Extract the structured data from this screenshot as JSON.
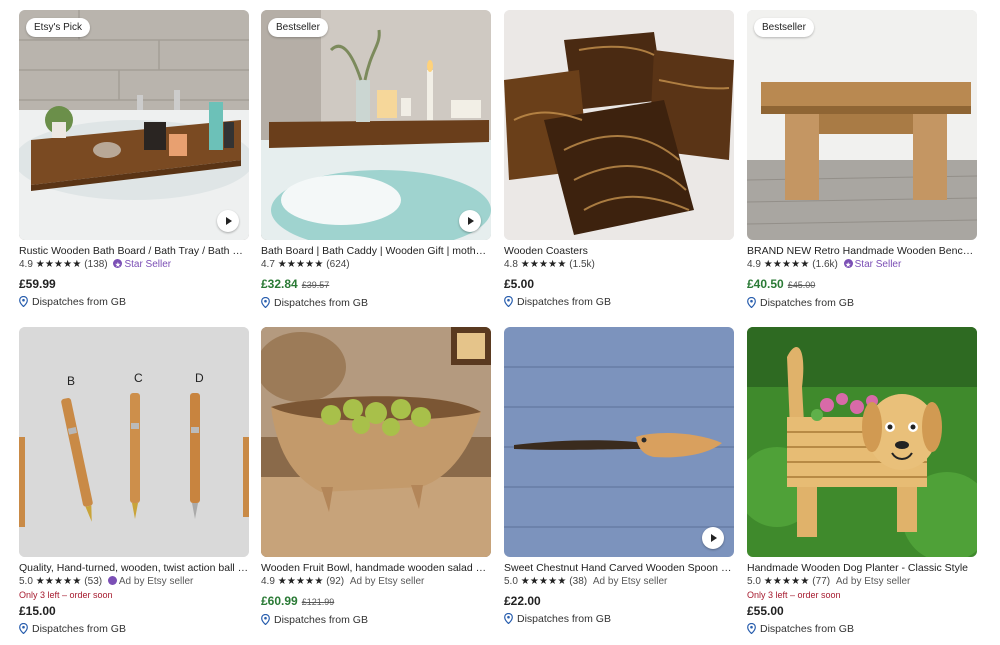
{
  "listings": [
    {
      "badge": "Etsy's Pick",
      "title": "Rustic Wooden Bath Board / Bath Tray / Bath Caddy",
      "rating": "4.9",
      "reviews": "(138)",
      "seller_badge": "Star Seller",
      "price": "£59.99",
      "dispatch": "Dispatches from GB",
      "video": true
    },
    {
      "badge": "Bestseller",
      "title": "Bath Board | Bath Caddy | Wooden Gift | mothers day gift",
      "rating": "4.7",
      "reviews": "(624)",
      "price": "£32.84",
      "original_price": "£39.57",
      "dispatch": "Dispatches from GB",
      "video": true
    },
    {
      "title": "Wooden Coasters",
      "rating": "4.8",
      "reviews": "(1.5k)",
      "price": "£5.00",
      "dispatch": "Dispatches from GB"
    },
    {
      "badge": "Bestseller",
      "title": "BRAND NEW Retro Handmade Wooden Bench-Stool",
      "rating": "4.9",
      "reviews": "(1.6k)",
      "seller_badge": "Star Seller",
      "price": "£40.50",
      "original_price": "£45.00",
      "dispatch": "Dispatches from GB"
    },
    {
      "title": "Quality, Hand-turned, wooden, twist action ball point pen",
      "rating": "5.0",
      "reviews": "(53)",
      "seller_badge": "Ad by Etsy seller",
      "scarcity": "Only 3 left – order soon",
      "price": "£15.00",
      "dispatch": "Dispatches from GB"
    },
    {
      "title": "Wooden Fruit Bowl, handmade wooden salad bowl",
      "rating": "4.9",
      "reviews": "(92)",
      "seller_badge": "Ad by Etsy seller",
      "price": "£60.99",
      "original_price": "£121.99",
      "dispatch": "Dispatches from GB"
    },
    {
      "title": "Sweet Chestnut Hand Carved Wooden Spoon with Hook",
      "rating": "5.0",
      "reviews": "(38)",
      "seller_badge": "Ad by Etsy seller",
      "price": "£22.00",
      "dispatch": "Dispatches from GB",
      "video": true
    },
    {
      "title": "Handmade Wooden Dog Planter - Classic Style",
      "rating": "5.0",
      "reviews": "(77)",
      "seller_badge": "Ad by Etsy seller",
      "scarcity": "Only 3 left – order soon",
      "price": "£55.00",
      "dispatch": "Dispatches from GB"
    }
  ],
  "icons": {
    "star": "★",
    "location": "location-pin-icon",
    "play": "play-icon"
  },
  "colors": {
    "sale_price": "#2a7a35",
    "star_seller": "#7b4fb5",
    "scarcity": "#a61a2e"
  }
}
